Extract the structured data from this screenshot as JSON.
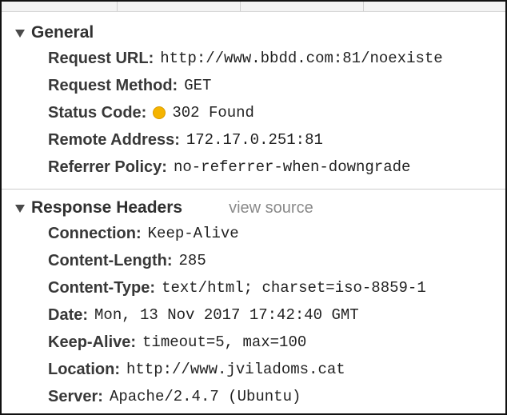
{
  "general": {
    "title": "General",
    "rows": [
      {
        "key": "Request URL:",
        "value": "http://www.bbdd.com:81/noexiste"
      },
      {
        "key": "Request Method:",
        "value": "GET"
      },
      {
        "key": "Status Code:",
        "value": "302 Found"
      },
      {
        "key": "Remote Address:",
        "value": "172.17.0.251:81"
      },
      {
        "key": "Referrer Policy:",
        "value": "no-referrer-when-downgrade"
      }
    ],
    "status_color": "#f5b400"
  },
  "response_headers": {
    "title": "Response Headers",
    "view_source_label": "view source",
    "rows": [
      {
        "key": "Connection:",
        "value": "Keep-Alive"
      },
      {
        "key": "Content-Length:",
        "value": "285"
      },
      {
        "key": "Content-Type:",
        "value": "text/html; charset=iso-8859-1"
      },
      {
        "key": "Date:",
        "value": "Mon, 13 Nov 2017 17:42:40 GMT"
      },
      {
        "key": "Keep-Alive:",
        "value": "timeout=5, max=100"
      },
      {
        "key": "Location:",
        "value": "http://www.jviladoms.cat"
      },
      {
        "key": "Server:",
        "value": "Apache/2.4.7 (Ubuntu)"
      }
    ]
  },
  "icons": {
    "section_toggle": "triangle-down-icon",
    "status_indicator": "status-dot-icon"
  }
}
